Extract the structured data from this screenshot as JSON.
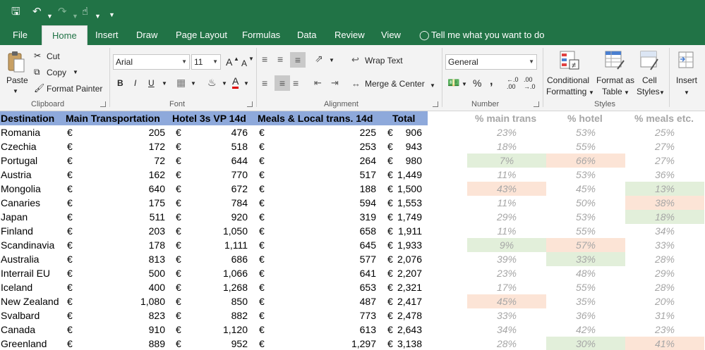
{
  "titlebar": {
    "tell_me": "Tell me what you want to do"
  },
  "tabs": [
    {
      "label": "File"
    },
    {
      "label": "Home"
    },
    {
      "label": "Insert"
    },
    {
      "label": "Draw"
    },
    {
      "label": "Page Layout"
    },
    {
      "label": "Formulas"
    },
    {
      "label": "Data"
    },
    {
      "label": "Review"
    },
    {
      "label": "View"
    }
  ],
  "ribbon": {
    "clipboard": {
      "paste": "Paste",
      "cut": "Cut",
      "copy": "Copy",
      "format_painter": "Format Painter",
      "label": "Clipboard"
    },
    "font": {
      "name": "Arial",
      "size": "11",
      "label": "Font",
      "bold": "B",
      "italic": "I",
      "underline": "U",
      "grow": "A",
      "shrink": "A",
      "font_color_letter": "A"
    },
    "alignment": {
      "wrap_text": "Wrap Text",
      "merge_center": "Merge & Center",
      "label": "Alignment"
    },
    "number": {
      "format": "General",
      "percent": "%",
      "comma": ",",
      "label": "Number"
    },
    "styles": {
      "conditional": "Conditional",
      "formatting": "Formatting",
      "format_as": "Format as",
      "table": "Table",
      "cell": "Cell",
      "cell_styles": "Styles",
      "label": "Styles"
    },
    "cells": {
      "insert": "Insert"
    }
  },
  "sheet": {
    "headers": {
      "destination": "Destination",
      "main_transport": "Main Transportation",
      "hotel": "Hotel 3s VP 14d",
      "meals": "Meals & Local trans. 14d",
      "total": "Total",
      "pct_main": "% main trans",
      "pct_hotel": "% hotel",
      "pct_meals": "% meals etc."
    },
    "currency": "€",
    "rows": [
      {
        "dest": "Romania",
        "main": "205",
        "hotel": "476",
        "meals": "225",
        "total": "906",
        "p_main": "23%",
        "p_hotel": "53%",
        "p_meals": "25%",
        "hl_main": "",
        "hl_hotel": "",
        "hl_meals": ""
      },
      {
        "dest": "Czechia",
        "main": "172",
        "hotel": "518",
        "meals": "253",
        "total": "943",
        "p_main": "18%",
        "p_hotel": "55%",
        "p_meals": "27%",
        "hl_main": "",
        "hl_hotel": "",
        "hl_meals": ""
      },
      {
        "dest": "Portugal",
        "main": "72",
        "hotel": "644",
        "meals": "264",
        "total": "980",
        "p_main": "7%",
        "p_hotel": "66%",
        "p_meals": "27%",
        "hl_main": "green",
        "hl_hotel": "red",
        "hl_meals": ""
      },
      {
        "dest": "Austria",
        "main": "162",
        "hotel": "770",
        "meals": "517",
        "total": "1,449",
        "p_main": "11%",
        "p_hotel": "53%",
        "p_meals": "36%",
        "hl_main": "",
        "hl_hotel": "",
        "hl_meals": ""
      },
      {
        "dest": "Mongolia",
        "main": "640",
        "hotel": "672",
        "meals": "188",
        "total": "1,500",
        "p_main": "43%",
        "p_hotel": "45%",
        "p_meals": "13%",
        "hl_main": "red",
        "hl_hotel": "",
        "hl_meals": "green"
      },
      {
        "dest": "Canaries",
        "main": "175",
        "hotel": "784",
        "meals": "594",
        "total": "1,553",
        "p_main": "11%",
        "p_hotel": "50%",
        "p_meals": "38%",
        "hl_main": "",
        "hl_hotel": "",
        "hl_meals": "red"
      },
      {
        "dest": "Japan",
        "main": "511",
        "hotel": "920",
        "meals": "319",
        "total": "1,749",
        "p_main": "29%",
        "p_hotel": "53%",
        "p_meals": "18%",
        "hl_main": "",
        "hl_hotel": "",
        "hl_meals": "green"
      },
      {
        "dest": "Finland",
        "main": "203",
        "hotel": "1,050",
        "meals": "658",
        "total": "1,911",
        "p_main": "11%",
        "p_hotel": "55%",
        "p_meals": "34%",
        "hl_main": "",
        "hl_hotel": "",
        "hl_meals": ""
      },
      {
        "dest": "Scandinavia",
        "main": "178",
        "hotel": "1,111",
        "meals": "645",
        "total": "1,933",
        "p_main": "9%",
        "p_hotel": "57%",
        "p_meals": "33%",
        "hl_main": "green",
        "hl_hotel": "red",
        "hl_meals": ""
      },
      {
        "dest": "Australia",
        "main": "813",
        "hotel": "686",
        "meals": "577",
        "total": "2,076",
        "p_main": "39%",
        "p_hotel": "33%",
        "p_meals": "28%",
        "hl_main": "",
        "hl_hotel": "green",
        "hl_meals": ""
      },
      {
        "dest": "Interrail EU",
        "main": "500",
        "hotel": "1,066",
        "meals": "641",
        "total": "2,207",
        "p_main": "23%",
        "p_hotel": "48%",
        "p_meals": "29%",
        "hl_main": "",
        "hl_hotel": "",
        "hl_meals": ""
      },
      {
        "dest": "Iceland",
        "main": "400",
        "hotel": "1,268",
        "meals": "653",
        "total": "2,321",
        "p_main": "17%",
        "p_hotel": "55%",
        "p_meals": "28%",
        "hl_main": "",
        "hl_hotel": "",
        "hl_meals": ""
      },
      {
        "dest": "New Zealand",
        "main": "1,080",
        "hotel": "850",
        "meals": "487",
        "total": "2,417",
        "p_main": "45%",
        "p_hotel": "35%",
        "p_meals": "20%",
        "hl_main": "red",
        "hl_hotel": "",
        "hl_meals": ""
      },
      {
        "dest": "Svalbard",
        "main": "823",
        "hotel": "882",
        "meals": "773",
        "total": "2,478",
        "p_main": "33%",
        "p_hotel": "36%",
        "p_meals": "31%",
        "hl_main": "",
        "hl_hotel": "",
        "hl_meals": ""
      },
      {
        "dest": "Canada",
        "main": "910",
        "hotel": "1,120",
        "meals": "613",
        "total": "2,643",
        "p_main": "34%",
        "p_hotel": "42%",
        "p_meals": "23%",
        "hl_main": "",
        "hl_hotel": "",
        "hl_meals": ""
      },
      {
        "dest": "Greenland",
        "main": "889",
        "hotel": "952",
        "meals": "1,297",
        "total": "3,138",
        "p_main": "28%",
        "p_hotel": "30%",
        "p_meals": "41%",
        "hl_main": "",
        "hl_hotel": "green",
        "hl_meals": "red"
      }
    ]
  },
  "colors": {
    "ribbon_green": "#217346",
    "header_blue": "#8ea9db",
    "highlight_green": "#e2efda",
    "highlight_red": "#fce4d6",
    "pct_text": "#a6a6a6"
  }
}
